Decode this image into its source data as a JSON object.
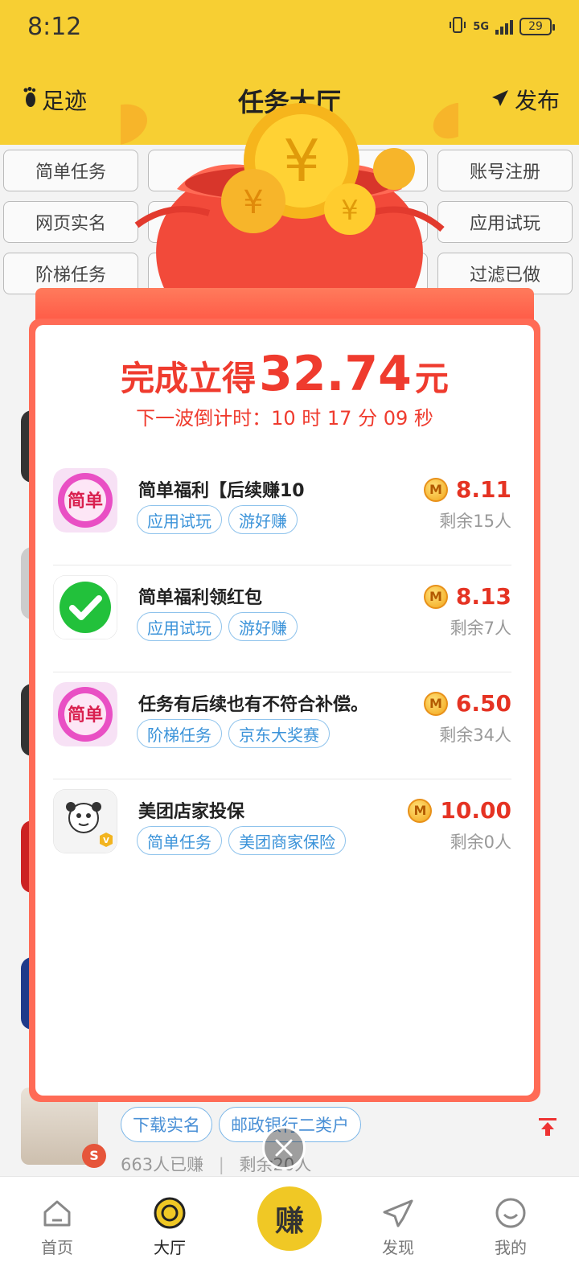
{
  "status_bar": {
    "time": "8:12",
    "network": "5G",
    "battery": "29"
  },
  "nav": {
    "left_label": "足迹",
    "title": "任务大厅",
    "right_label": "发布"
  },
  "categories": [
    "简单任务",
    "",
    "",
    "账号注册",
    "网页实名",
    "",
    "",
    "应用试玩",
    "阶梯任务",
    "",
    "",
    "过滤已做"
  ],
  "background_row": {
    "tags": [
      "下载实名",
      "邮政银行二类户"
    ],
    "earned": "663人已赚",
    "remaining": "剩余20人"
  },
  "bottom_nav": {
    "home": "首页",
    "hall": "大厅",
    "earn": "赚",
    "discover": "发现",
    "mine": "我的"
  },
  "popup": {
    "headline_prefix": "完成立得",
    "headline_amount": "32.74",
    "headline_unit": "元",
    "countdown": "下一波倒计时：10 时 17 分 09 秒",
    "tasks": [
      {
        "title": "简单福利【后续赚10",
        "tags": [
          "应用试玩",
          "游好赚"
        ],
        "amount": "8.11",
        "remaining": "剩余15人",
        "icon": "jiandan-app-icon"
      },
      {
        "title": "简单福利领红包",
        "tags": [
          "应用试玩",
          "游好赚"
        ],
        "amount": "8.13",
        "remaining": "剩余7人",
        "icon": "wechat-check-icon"
      },
      {
        "title": "任务有后续也有不符合补偿。",
        "tags": [
          "阶梯任务",
          "京东大奖赛"
        ],
        "amount": "6.50",
        "remaining": "剩余34人",
        "icon": "jiandan-app-icon"
      },
      {
        "title": "美团店家投保",
        "tags": [
          "简单任务",
          "美团商家保险"
        ],
        "amount": "10.00",
        "remaining": "剩余0人",
        "icon": "meme-avatar-icon"
      }
    ]
  },
  "colors": {
    "brand_yellow": "#f7cf33",
    "popup_red": "#ef3b2e",
    "tag_blue": "#3b93d9"
  }
}
